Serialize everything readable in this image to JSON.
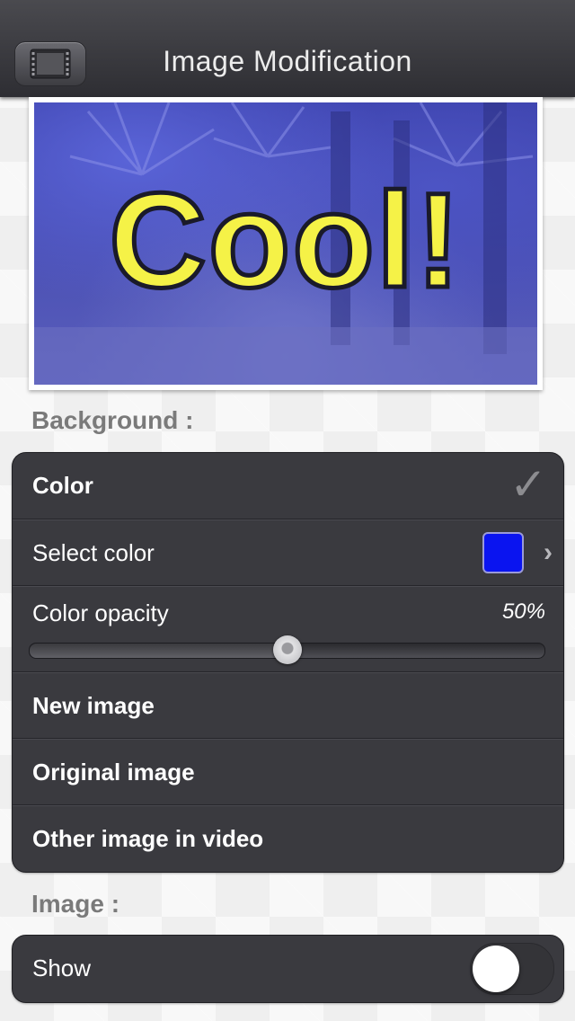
{
  "navbar": {
    "title": "Image Modification",
    "left_icon": "film-strip-icon"
  },
  "preview": {
    "overlay_text": "Cool!",
    "tint_color": "#0a14f0"
  },
  "background_section": {
    "label": "Background :",
    "color_row": {
      "label": "Color",
      "selected": true,
      "check_icon": "checkmark-icon"
    },
    "select_color_row": {
      "label": "Select color",
      "swatch_color": "#0a14f0",
      "chevron_icon": "chevron-right-icon"
    },
    "opacity_row": {
      "label": "Color opacity",
      "value_text": "50%",
      "value": 0.5
    },
    "new_image_label": "New image",
    "original_image_label": "Original image",
    "other_image_label": "Other image in video"
  },
  "image_section": {
    "label": "Image :",
    "show_row": {
      "label": "Show",
      "on": false
    }
  }
}
